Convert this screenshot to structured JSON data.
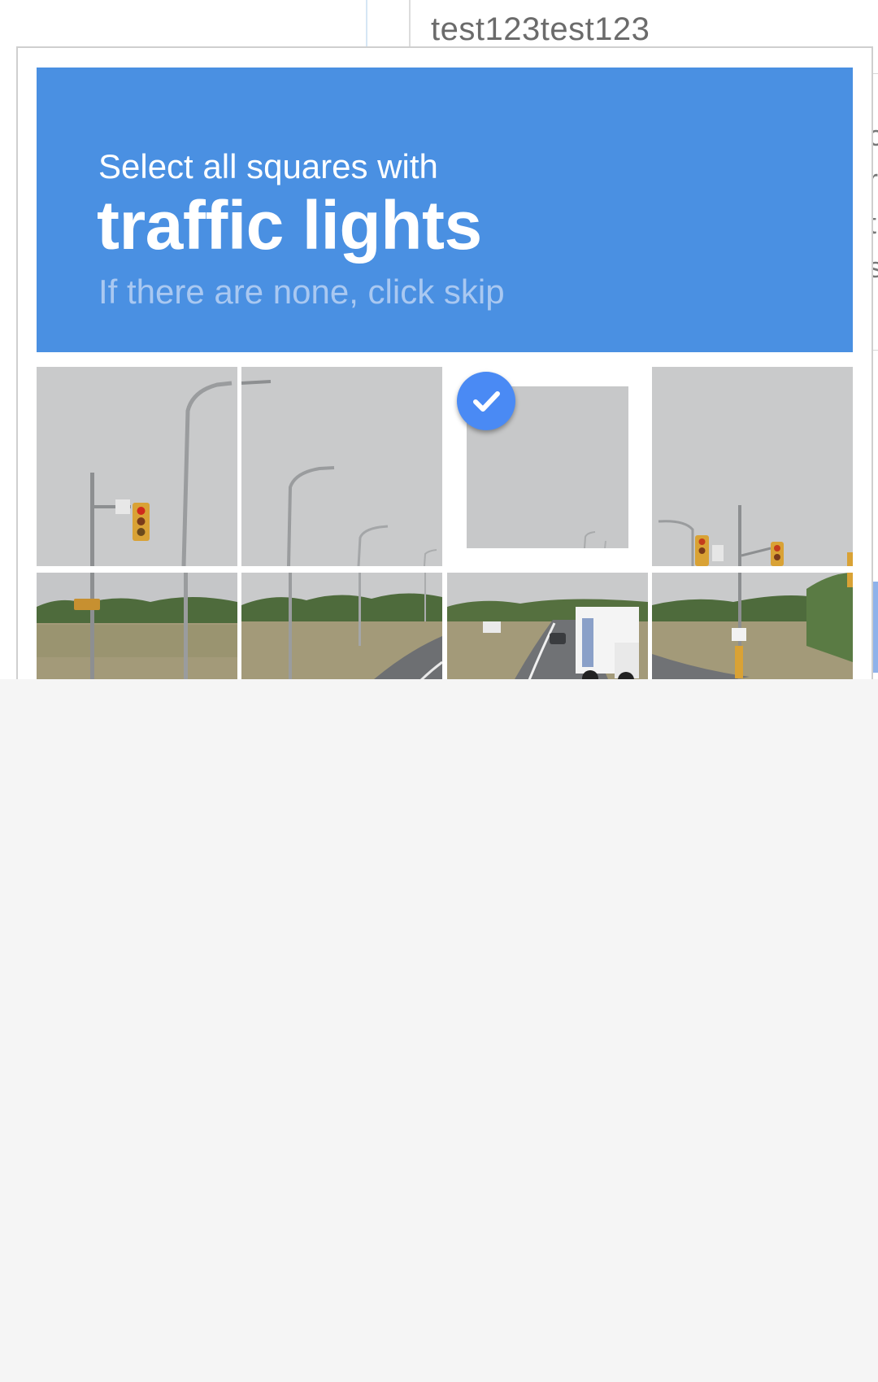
{
  "background": {
    "field_value": "test123test123",
    "side_letters": [
      "c",
      "r",
      "t",
      "s"
    ]
  },
  "captcha": {
    "instruction_line": "Select all squares with",
    "target_object": "traffic lights",
    "hint": "If there are none, click skip",
    "header_color": "#4a90e2",
    "check_color": "#4a8af4",
    "tiles": [
      {
        "id": "tile-1",
        "selected": false
      },
      {
        "id": "tile-2",
        "selected": false
      },
      {
        "id": "tile-3",
        "selected": true
      },
      {
        "id": "tile-4",
        "selected": false
      },
      {
        "id": "tile-5",
        "selected": false
      },
      {
        "id": "tile-6",
        "selected": false
      },
      {
        "id": "tile-7",
        "selected": false
      },
      {
        "id": "tile-8",
        "selected": false
      }
    ]
  },
  "icons": {
    "selected_check": "checkmark-icon"
  }
}
